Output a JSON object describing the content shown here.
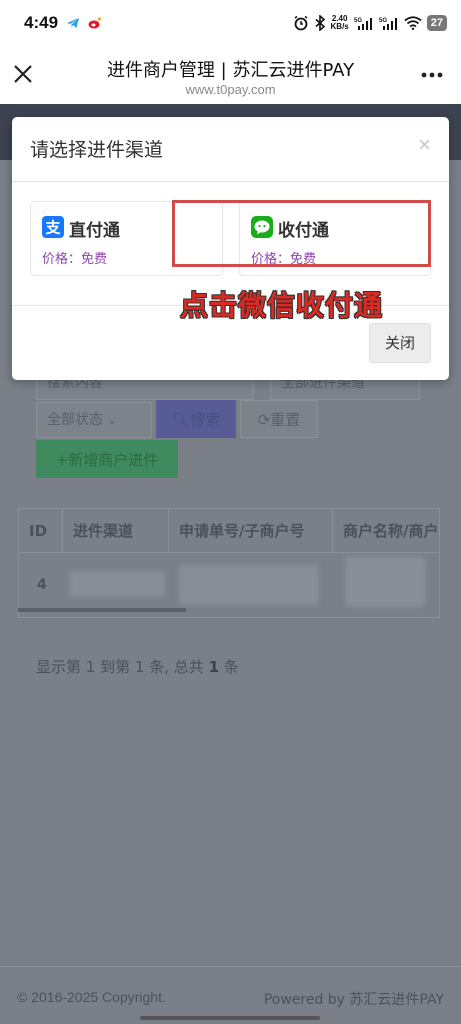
{
  "status_bar": {
    "time": "4:49",
    "net_speed": "2.40",
    "net_unit": "KB/s",
    "signal1": "5G",
    "signal2": "5G",
    "battery": "27"
  },
  "browser": {
    "title": "进件商户管理 | 苏汇云进件PAY",
    "url": "www.t0pay.com"
  },
  "page": {
    "search_placeholder": "搜索内容",
    "channel_filter": "全部进件渠道",
    "status_filter": "全部状态",
    "search_button": "搜索",
    "reset_button": "重置",
    "add_button": "新增商户进件",
    "table": {
      "columns": [
        "ID",
        "进件渠道",
        "申请单号/子商户号",
        "商户名称/商户"
      ],
      "rows": [
        {
          "id": "4"
        }
      ]
    },
    "pagination": {
      "prefix": "显示第",
      "from": "1",
      "mid1": "到第",
      "to": "1",
      "mid2": "条, 总共",
      "total": "1",
      "suffix": "条"
    },
    "footer": {
      "copyright": "© 2016-2025 Copyright.",
      "powered": "Powered by 苏汇云进件PAY"
    }
  },
  "modal": {
    "title": "请选择进件渠道",
    "close_symbol": "×",
    "channels": [
      {
        "name": "直付通",
        "price": "价格：免费",
        "icon": "alipay-icon",
        "color": "#1677ff"
      },
      {
        "name": "收付通",
        "price": "价格：免费",
        "icon": "wechat-icon",
        "color": "#1aad19"
      }
    ],
    "annotation": "点击微信收付通",
    "close_button": "关闭"
  }
}
